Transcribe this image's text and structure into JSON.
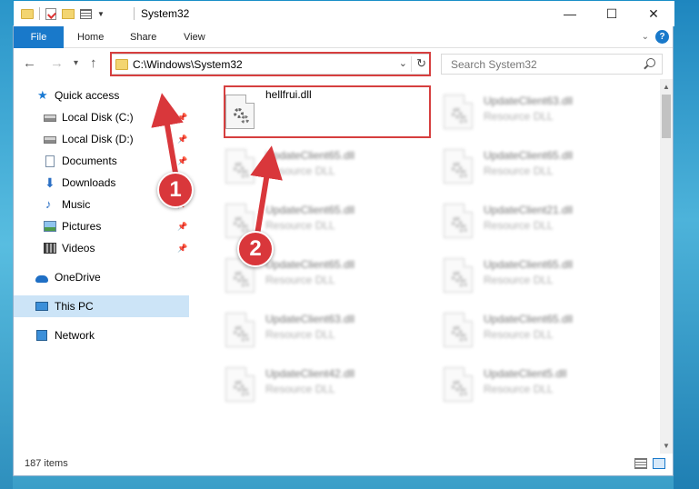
{
  "window": {
    "title": "System32",
    "controls": {
      "minimize": "—",
      "maximize": "☐",
      "close": "✕"
    }
  },
  "ribbon": {
    "tabs": [
      "File",
      "Home",
      "Share",
      "View"
    ],
    "help": "?"
  },
  "navigation": {
    "back": "←",
    "forward": "→",
    "recent": "▾",
    "up": "↑",
    "address_path": "C:\\Windows\\System32",
    "address_dropdown": "⌄",
    "refresh": "↻",
    "search_placeholder": "Search System32"
  },
  "sidebar": {
    "items": [
      {
        "label": "Quick access",
        "icon": "star-icon"
      },
      {
        "label": "Local Disk (C:)",
        "icon": "drive-icon",
        "pinned": true
      },
      {
        "label": "Local Disk (D:)",
        "icon": "drive-icon",
        "pinned": true
      },
      {
        "label": "Documents",
        "icon": "documents-icon",
        "pinned": true
      },
      {
        "label": "Downloads",
        "icon": "download-icon",
        "pinned": true
      },
      {
        "label": "Music",
        "icon": "music-icon",
        "pinned": true
      },
      {
        "label": "Pictures",
        "icon": "pictures-icon",
        "pinned": true
      },
      {
        "label": "Videos",
        "icon": "videos-icon",
        "pinned": true
      },
      {
        "label": "OneDrive",
        "icon": "onedrive-icon"
      },
      {
        "label": "This PC",
        "icon": "computer-icon",
        "selected": true
      },
      {
        "label": "Network",
        "icon": "network-icon"
      }
    ],
    "pin_glyph": "📌"
  },
  "files": [
    {
      "name": "hellfrui.dll",
      "type": "",
      "highlighted": true
    },
    {
      "name": "UpdateClient63.dll",
      "type": "Resource DLL"
    },
    {
      "name": "UpdateClient65.dll",
      "type": "Resource DLL"
    },
    {
      "name": "UpdateClient65.dll",
      "type": "Resource DLL"
    },
    {
      "name": "UpdateClient65.dll",
      "type": "Resource DLL"
    },
    {
      "name": "UpdateClient21.dll",
      "type": "Resource DLL"
    },
    {
      "name": "UpdateClient65.dll",
      "type": "Resource DLL"
    },
    {
      "name": "UpdateClient65.dll",
      "type": "Resource DLL"
    },
    {
      "name": "UpdateClient63.dll",
      "type": "Resource DLL"
    },
    {
      "name": "UpdateClient65.dll",
      "type": "Resource DLL"
    },
    {
      "name": "UpdateClient42.dll",
      "type": "Resource DLL"
    },
    {
      "name": "UpdateClient5.dll",
      "type": "Resource DLL"
    }
  ],
  "status": {
    "item_count": "187 items"
  },
  "callouts": [
    "1",
    "2"
  ],
  "colors": {
    "accent": "#1979ca",
    "highlight_red": "#d63f3f",
    "callout_red": "#d9373b",
    "selected_bg": "#cce4f7"
  }
}
